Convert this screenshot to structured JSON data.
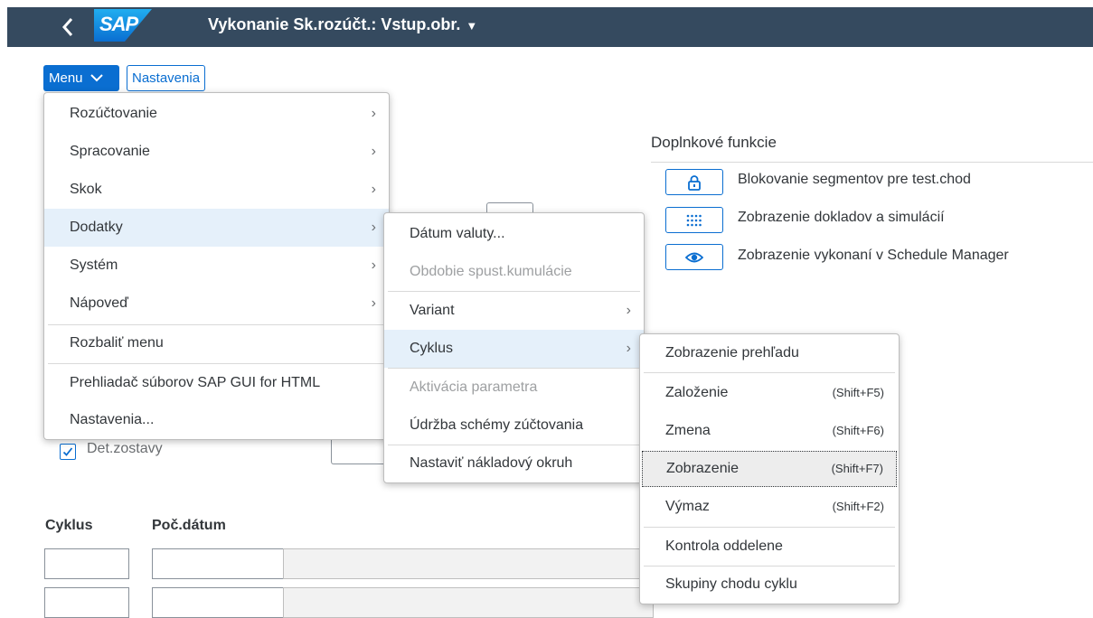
{
  "header": {
    "back_icon": "chevron-left-icon",
    "logo_text": "SAP",
    "title": "Vykonanie Sk.rozúčt.: Vstup.obr.",
    "title_caret": "▼"
  },
  "toolbar": {
    "menu_label": "Menu",
    "menu_icon": "chevron-down-icon",
    "settings_label": "Nastavenia"
  },
  "extras": {
    "title": "Doplnkové funkcie",
    "items": [
      {
        "icon": "lock-icon",
        "label": "Blokovanie segmentov pre test.chod"
      },
      {
        "icon": "dots-grid-icon",
        "label": "Zobrazenie dokladov a simulácií"
      },
      {
        "icon": "eye-icon",
        "label": "Zobrazenie vykonaní v Schedule Manager"
      }
    ]
  },
  "form": {
    "checkbox_label": "Det.zostavy",
    "checkbox_checked": true,
    "col_cycle": "Cyklus",
    "col_date": "Poč.dátum"
  },
  "menu1": {
    "items": [
      {
        "label": "Rozúčtovanie",
        "submenu": true
      },
      {
        "label": "Spracovanie",
        "submenu": true
      },
      {
        "label": "Skok",
        "submenu": true
      },
      {
        "label": "Dodatky",
        "submenu": true,
        "highlighted": true
      },
      {
        "label": "Systém",
        "submenu": true
      },
      {
        "label": "Nápoveď",
        "submenu": true
      },
      {
        "label": "Rozbaliť menu"
      },
      {
        "label": "Prehliadač súborov SAP GUI for HTML"
      },
      {
        "label": "Nastavenia..."
      }
    ]
  },
  "menu2": {
    "items": [
      {
        "label": "Dátum valuty..."
      },
      {
        "label": "Obdobie spust.kumulácie",
        "disabled": true
      },
      {
        "label": "Variant",
        "submenu": true
      },
      {
        "label": "Cyklus",
        "submenu": true,
        "highlighted": true
      },
      {
        "label": "Aktivácia parametra",
        "disabled": true
      },
      {
        "label": "Údržba schémy zúčtovania"
      },
      {
        "label": "Nastaviť nákladový okruh"
      }
    ]
  },
  "menu3": {
    "items": [
      {
        "label": "Zobrazenie prehľadu"
      },
      {
        "label": "Založenie",
        "shortcut": "(Shift+F5)"
      },
      {
        "label": "Zmena",
        "shortcut": "(Shift+F6)"
      },
      {
        "label": "Zobrazenie",
        "shortcut": "(Shift+F7)",
        "focused": true
      },
      {
        "label": "Výmaz",
        "shortcut": "(Shift+F2)"
      },
      {
        "label": "Kontrola oddelene"
      },
      {
        "label": "Skupiny chodu cyklu"
      }
    ]
  },
  "colors": {
    "shell": "#354a5f",
    "accent": "#0a6ed1",
    "highlight": "#e5f0fa"
  }
}
